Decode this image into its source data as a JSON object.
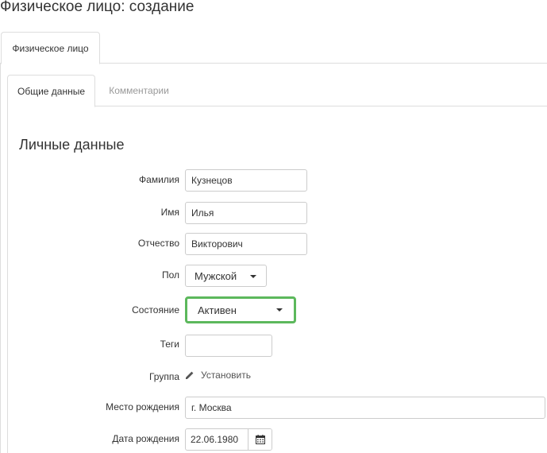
{
  "page": {
    "title": "Физическое лицо: создание"
  },
  "tabs": {
    "outer": [
      {
        "label": "Физическое лицо",
        "active": true
      }
    ],
    "inner": [
      {
        "label": "Общие данные",
        "active": true
      },
      {
        "label": "Комментарии",
        "active": false
      }
    ]
  },
  "section": {
    "title": "Личные данные"
  },
  "form": {
    "last_name": {
      "label": "Фамилия",
      "value": "Кузнецов"
    },
    "first_name": {
      "label": "Имя",
      "value": "Илья"
    },
    "middle_name": {
      "label": "Отчество",
      "value": "Викторович"
    },
    "gender": {
      "label": "Пол",
      "value": "Мужской"
    },
    "status": {
      "label": "Состояние",
      "value": "Активен"
    },
    "tags": {
      "label": "Теги",
      "value": ""
    },
    "group": {
      "label": "Группа",
      "action": "Установить",
      "icon": "pencil-icon"
    },
    "birth_place": {
      "label": "Место рождения",
      "value": "г. Москва"
    },
    "birth_date": {
      "label": "Дата рождения",
      "value": "22.06.1980",
      "icon": "calendar-icon"
    }
  },
  "colors": {
    "focus_border": "#5cb85c",
    "tab_border": "#dddddd",
    "inactive_tab_text": "#999999"
  }
}
